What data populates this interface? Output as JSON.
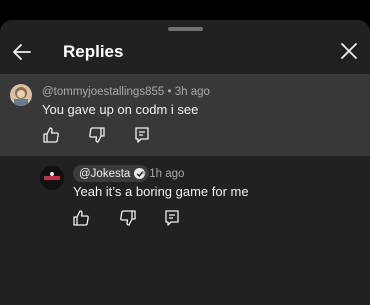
{
  "header": {
    "title": "Replies",
    "back_icon": "arrow-left-icon",
    "close_icon": "close-icon"
  },
  "parent_comment": {
    "author": "@tommyjoestallings855",
    "time": "3h ago",
    "separator": "•",
    "text": "You gave up on codm i see",
    "avatar_colors": [
      "#8c6b4f",
      "#d9c2a3"
    ]
  },
  "reply": {
    "author": "@Jokesta",
    "verified_icon": "checkmark-badge-icon",
    "time": "1h ago",
    "separator": "•",
    "text": "Yeah it’s a boring game for me",
    "avatar_colors": [
      "#111111",
      "#c0304a"
    ]
  },
  "actions": {
    "like_icon": "thumbs-up-icon",
    "dislike_icon": "thumbs-down-icon",
    "reply_icon": "comment-icon"
  },
  "colors": {
    "sheet": "#212121",
    "highlight": "#383838",
    "text": "#f1f1f1",
    "muted": "#aaaaaa"
  }
}
